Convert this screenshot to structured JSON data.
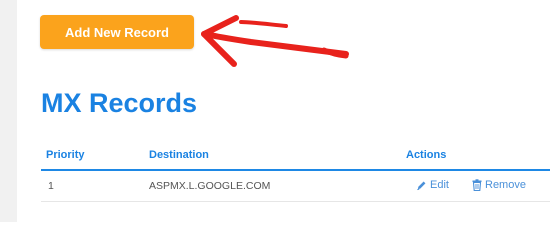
{
  "toolbar": {
    "add_label": "Add New Record"
  },
  "section": {
    "title": "MX Records"
  },
  "table": {
    "columns": [
      "Priority",
      "Destination",
      "Actions"
    ],
    "rows": [
      {
        "priority": "1",
        "destination": "ASPMX.L.GOOGLE.COM",
        "edit_label": "Edit",
        "remove_label": "Remove"
      }
    ]
  },
  "colors": {
    "accent_orange": "#fba31c",
    "title_blue": "#1a82e2",
    "action_blue": "#4a90d9",
    "arrow_red": "#e8221c"
  },
  "icons": {
    "edit": "pencil-icon",
    "remove": "trash-icon",
    "annotation": "red-arrow-icon"
  }
}
